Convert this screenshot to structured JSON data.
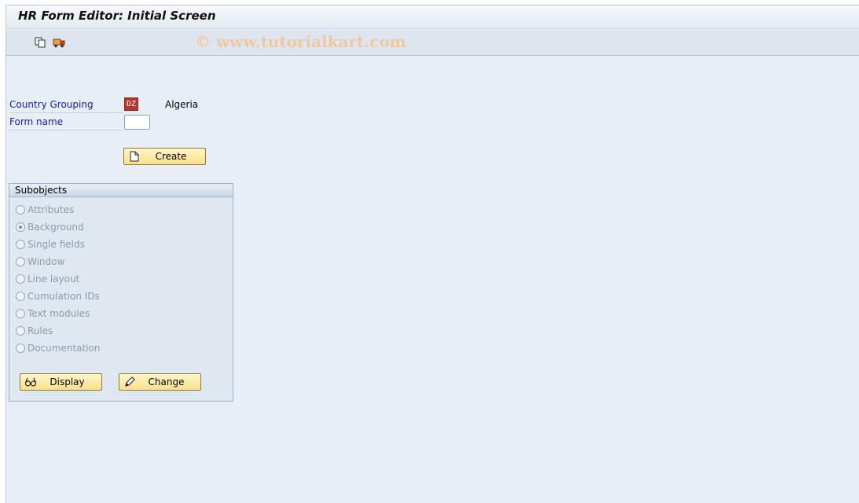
{
  "window": {
    "title": "HR Form Editor: Initial Screen"
  },
  "toolbar": {
    "watermark": "© www.tutorialkart.com",
    "icons": [
      "copy-icon",
      "transport-icon"
    ]
  },
  "fields": {
    "country_grouping": {
      "label": "Country Grouping",
      "value": "DZ",
      "text": "Algeria"
    },
    "form_name": {
      "label": "Form name",
      "value": ""
    }
  },
  "buttons": {
    "create": "Create",
    "display": "Display",
    "change": "Change"
  },
  "subobjects": {
    "title": "Subobjects",
    "options": [
      {
        "label": "Attributes",
        "checked": false
      },
      {
        "label": "Background",
        "checked": true
      },
      {
        "label": "Single fields",
        "checked": false
      },
      {
        "label": "Window",
        "checked": false
      },
      {
        "label": "Line layout",
        "checked": false
      },
      {
        "label": "Cumulation IDs",
        "checked": false
      },
      {
        "label": "Text modules",
        "checked": false
      },
      {
        "label": "Rules",
        "checked": false
      },
      {
        "label": "Documentation",
        "checked": false
      }
    ]
  },
  "colors": {
    "label_blue": "#1b1bb5",
    "button_yellow": "#fbe089",
    "key_red": "#b8352f"
  }
}
